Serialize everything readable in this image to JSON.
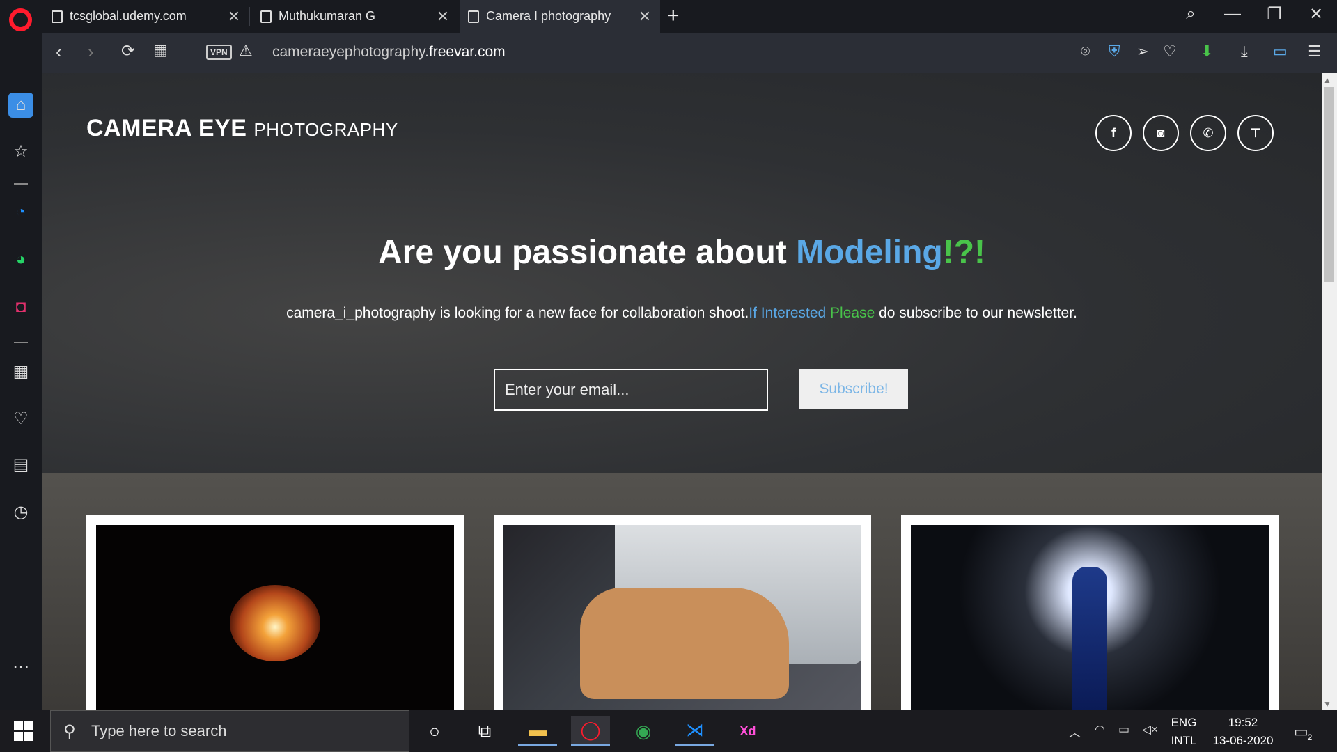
{
  "tabs": [
    {
      "label": "tcsglobal.udemy.com",
      "close": "✕"
    },
    {
      "label": "Muthukumaran G",
      "close": "✕"
    },
    {
      "label": "Camera I photography",
      "close": "✕"
    }
  ],
  "new_tab": "+",
  "window": {
    "minimize": "—",
    "restore": "❐",
    "close": "✕"
  },
  "address": {
    "vpn": "VPN",
    "url_prefix": "cameraeyephotography.",
    "url_domain": "freevar.com"
  },
  "page": {
    "brand_bold": "CAMERA EYE",
    "brand_light": "PHOTOGRAPHY",
    "social": [
      {
        "name": "facebook",
        "glyph": "f"
      },
      {
        "name": "instagram",
        "glyph": "◙"
      },
      {
        "name": "phone",
        "glyph": "✆"
      },
      {
        "name": "sitemap",
        "glyph": "⊤"
      }
    ],
    "headline_pre": "Are you passionate about ",
    "headline_highlight": "Modeling",
    "headline_punct": "!?!",
    "sub_pre": "camera_i_photography is looking for a new face for collaboration shoot.",
    "sub_a": "If Interested",
    "sub_b": " Please",
    "sub_post": " do subscribe to our newsletter.",
    "email_placeholder": "Enter your email...",
    "subscribe_label": "Subscribe!"
  },
  "taskbar": {
    "search_placeholder": "Type here to search",
    "lang_top": "ENG",
    "lang_bottom": "INTL",
    "time": "19:52",
    "date": "13-06-2020",
    "notifications": "2"
  },
  "colors": {
    "accent_blue": "#5aa8e6",
    "accent_green": "#49c44a",
    "opera_red": "#ff1b2d"
  }
}
